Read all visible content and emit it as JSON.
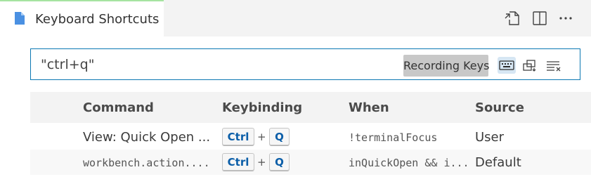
{
  "tab": {
    "title": "Keyboard Shortcuts",
    "icon": "file-icon"
  },
  "editor_actions": [
    {
      "name": "open-keybindings-json-icon"
    },
    {
      "name": "split-editor-icon"
    },
    {
      "name": "more-actions-icon"
    }
  ],
  "search": {
    "value": "\"ctrl+q\"",
    "badge": "Recording Keys",
    "buttons": [
      "keyboard-icon",
      "sort-by-precedence-icon",
      "clear-search-icon"
    ]
  },
  "table": {
    "headers": {
      "command": "Command",
      "keybinding": "Keybinding",
      "when": "When",
      "source": "Source"
    },
    "rows": [
      {
        "command": "View: Quick Open ...",
        "command_mono": false,
        "keys": [
          "Ctrl",
          "+",
          "Q"
        ],
        "when": "!terminalFocus",
        "source": "User"
      },
      {
        "command": "workbench.action....",
        "command_mono": true,
        "keys": [
          "Ctrl",
          "+",
          "Q"
        ],
        "when": "inQuickOpen && i...",
        "source": "Default"
      }
    ]
  },
  "colors": {
    "accent": "#0b78b3",
    "kbd_text": "#0b5ea8",
    "active_tab_border": "#a6e3a1"
  }
}
